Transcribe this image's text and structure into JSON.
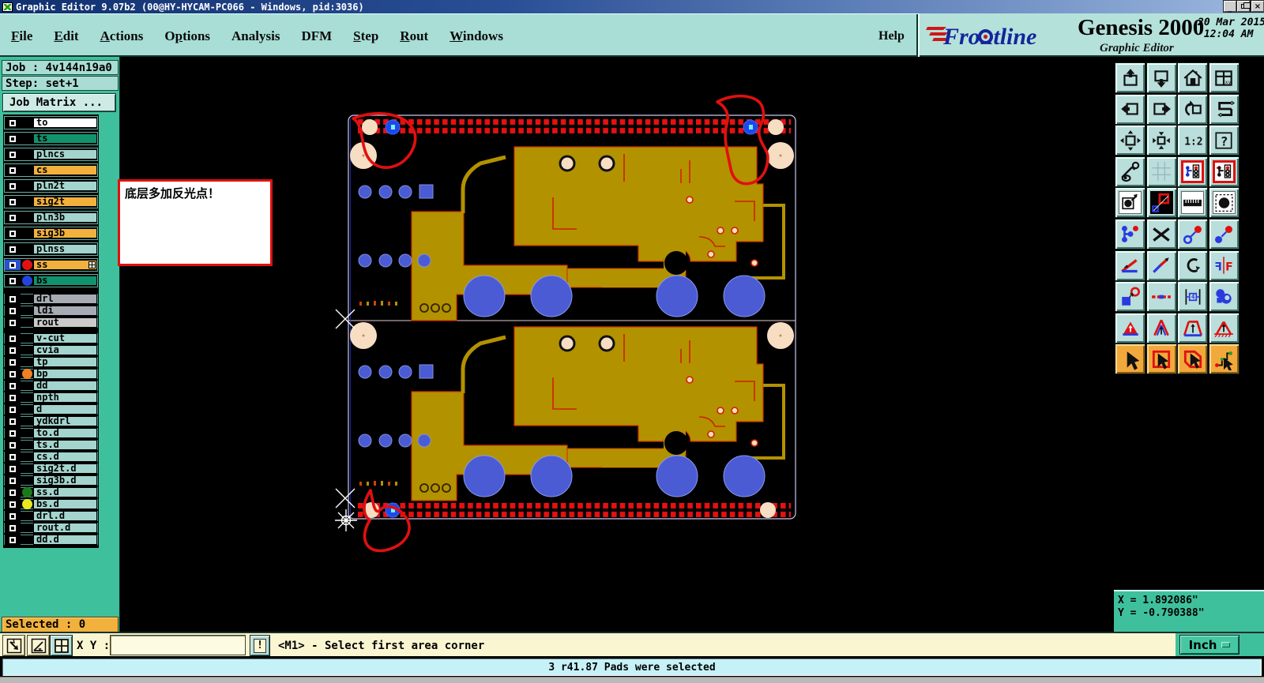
{
  "window": {
    "title": "Graphic Editor 9.07b2  (00@HY-HYCAM-PC066 - Windows, pid:3036)",
    "controls": {
      "minimize": "_",
      "restore": "restore",
      "close": "X"
    }
  },
  "menubar": {
    "items": [
      {
        "label": "File",
        "u": 0
      },
      {
        "label": "Edit",
        "u": 0
      },
      {
        "label": "Actions",
        "u": 0
      },
      {
        "label": "Options",
        "u": 1
      },
      {
        "label": "Analysis",
        "u": null
      },
      {
        "label": "DFM",
        "u": null
      },
      {
        "label": "Step",
        "u": 0
      },
      {
        "label": "Rout",
        "u": 0
      },
      {
        "label": "Windows",
        "u": 0
      }
    ],
    "help_label": "Help"
  },
  "brand": {
    "logo": "Frontline",
    "product": "Genesis 2000",
    "subtitle": "Graphic Editor",
    "datetime": "20 Mar 2015\n 12:04 AM"
  },
  "job_panel": {
    "job_label": "Job : 4v144n19a0",
    "step_label": "Step: set+1",
    "matrix_button": "Job Matrix ..."
  },
  "layers": {
    "groups": [
      {
        "items": [
          {
            "name": "to",
            "bg": "#ffffff"
          },
          {
            "name": "ts",
            "bg": "#11936d"
          },
          {
            "name": "plncs",
            "bg": "#a4d4ce"
          },
          {
            "name": "cs",
            "bg": "#f2b13d"
          },
          {
            "name": "pln2t",
            "bg": "#a4d4ce"
          },
          {
            "name": "sig2t",
            "bg": "#f2b13d"
          },
          {
            "name": "pln3b",
            "bg": "#a4d4ce"
          },
          {
            "name": "sig3b",
            "bg": "#f2b13d"
          },
          {
            "name": "plnss",
            "bg": "#a4d4ce"
          },
          {
            "name": "ss",
            "bg": "#f2b13d",
            "dot": "#e01212",
            "cb": "#2952cc",
            "grid": true
          },
          {
            "name": "bs",
            "bg": "#11936d",
            "dot": "#2244dd"
          }
        ]
      },
      {
        "items": [
          {
            "name": "drl",
            "bg": "#a7acb4"
          },
          {
            "name": "ldi",
            "bg": "#a7acb4"
          },
          {
            "name": "rout",
            "bg": "#cbcbcb"
          }
        ]
      },
      {
        "items": [
          {
            "name": "v-cut",
            "bg": "#a4d4ce"
          },
          {
            "name": "cvia",
            "bg": "#a4d4ce"
          },
          {
            "name": "tp",
            "bg": "#a4d4ce"
          },
          {
            "name": "bp",
            "bg": "#a4d4ce",
            "dot": "#f08020"
          },
          {
            "name": "dd",
            "bg": "#a4d4ce"
          },
          {
            "name": "npth",
            "bg": "#a4d4ce"
          },
          {
            "name": "d",
            "bg": "#a4d4ce"
          },
          {
            "name": "ydkdrl",
            "bg": "#a4d4ce"
          },
          {
            "name": "to.d",
            "bg": "#a4d4ce"
          },
          {
            "name": "ts.d",
            "bg": "#a4d4ce"
          },
          {
            "name": "cs.d",
            "bg": "#a4d4ce"
          },
          {
            "name": "sig2t.d",
            "bg": "#a4d4ce"
          },
          {
            "name": "sig3b.d",
            "bg": "#a4d4ce"
          },
          {
            "name": "ss.d",
            "bg": "#a4d4ce",
            "dot": "#1a7a1a"
          },
          {
            "name": "bs.d",
            "bg": "#a4d4ce",
            "dot": "#e8e820"
          },
          {
            "name": "drl.d",
            "bg": "#a4d4ce"
          },
          {
            "name": "rout.d",
            "bg": "#a4d4ce"
          },
          {
            "name": "dd.d",
            "bg": "#a4d4ce"
          }
        ]
      }
    ],
    "selected_label": "Selected : 0"
  },
  "canvas": {
    "annotation_text": "底层多加反光点！"
  },
  "toolbar": {
    "buttons": [
      {
        "n": "view-slide-up-icon"
      },
      {
        "n": "view-slide-down-icon"
      },
      {
        "n": "home-view-icon"
      },
      {
        "n": "window-xy-icon"
      },
      {
        "n": "view-slide-left-icon"
      },
      {
        "n": "view-slide-right-icon"
      },
      {
        "n": "previous-view-icon"
      },
      {
        "n": "serpentine-route-icon"
      },
      {
        "n": "fit-view-icon"
      },
      {
        "n": "pan-center-icon"
      },
      {
        "n": "zoom-ratio-icon",
        "t": "1:2"
      },
      {
        "n": "context-help-icon",
        "t": "?"
      },
      {
        "n": "setup-tools-icon"
      },
      {
        "n": "grid-toggle-icon"
      },
      {
        "n": "highlight-net-blue-icon",
        "v": "r"
      },
      {
        "n": "highlight-net-black-icon",
        "v": "r"
      },
      {
        "n": "copy-circle-icon",
        "v": "w"
      },
      {
        "n": "transform-shapes-icon",
        "v": "k"
      },
      {
        "n": "measure-ruler-icon",
        "v": "w"
      },
      {
        "n": "select-pad-icon",
        "v": "w"
      },
      {
        "n": "net-endpoints-icon"
      },
      {
        "n": "delete-cross-icon"
      },
      {
        "n": "move-open-circle-icon"
      },
      {
        "n": "move-solid-circle-icon"
      },
      {
        "n": "angle-snap-icon"
      },
      {
        "n": "line-arrow-icon"
      },
      {
        "n": "rotate-icon"
      },
      {
        "n": "mirror-icon",
        "t": "F"
      },
      {
        "n": "swap-shapes-icon"
      },
      {
        "n": "break-line-icon"
      },
      {
        "n": "resize-gap-icon",
        "t": "4"
      },
      {
        "n": "merge-shapes-icon"
      },
      {
        "n": "tri-solid-arrow-icon"
      },
      {
        "n": "tri-outline-arrow-icon"
      },
      {
        "n": "tri-flat-arrow-icon"
      },
      {
        "n": "tri-hatched-arrow-icon"
      },
      {
        "n": "select-mode-point-icon",
        "v": "m"
      },
      {
        "n": "select-mode-frame-icon",
        "v": "m"
      },
      {
        "n": "select-mode-polygon-icon",
        "v": "m"
      },
      {
        "n": "select-mode-net-icon",
        "v": "m"
      }
    ]
  },
  "readout": {
    "x": "X = 1.892086\"",
    "y": "Y = -0.790388\""
  },
  "commandbar": {
    "xy_label": "X Y :",
    "input_value": "",
    "bang": "!",
    "prompt": "<M1> - Select first area corner",
    "unit": "Inch"
  },
  "statusbar": {
    "message": "3 r41.87 Pads were selected"
  },
  "colors": {
    "accent_teal": "#3fc09c",
    "panel_teal": "#a8ded6",
    "copper_gold": "#b39200",
    "drill_blue": "#4a5bd4",
    "pad_peach": "#f7ddc2",
    "annotation_red": "#e01010",
    "selected_orange": "#f2b13d"
  }
}
